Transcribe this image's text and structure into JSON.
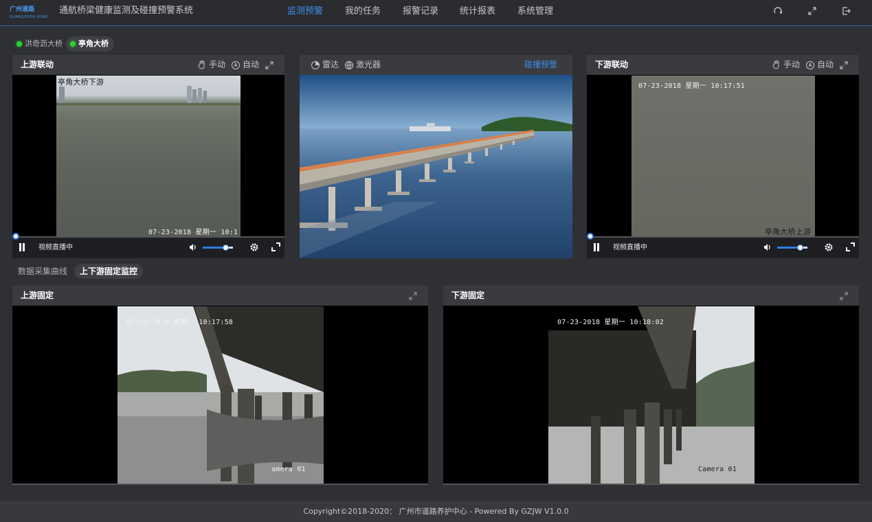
{
  "header": {
    "logo_text": "广州道路",
    "logo_sub": "GUANGZHOU ROAD",
    "title": "通航桥梁健康监测及碰撞预警系统",
    "nav": [
      {
        "label": "监测预警",
        "active": true
      },
      {
        "label": "我的任务",
        "active": false
      },
      {
        "label": "报警记录",
        "active": false
      },
      {
        "label": "统计报表",
        "active": false
      },
      {
        "label": "系统管理",
        "active": false
      }
    ],
    "icons": [
      "refresh-icon",
      "fullscreen-icon",
      "logout-icon"
    ]
  },
  "bridges": [
    {
      "label": "洪奇沥大桥",
      "status": "online",
      "active": false
    },
    {
      "label": "亭角大桥",
      "status": "online",
      "active": true
    }
  ],
  "panels": {
    "upstream_linked": {
      "title": "上游联动",
      "manual_label": "手动",
      "auto_label": "自动",
      "overlay_top": "亭角大桥下游",
      "timestamp": "07-23-2018 星期一 10:1",
      "status": "视频直播中",
      "volume": 0.75
    },
    "center": {
      "radar_label": "雷达",
      "laser_label": "激光器",
      "warning_label": "碰撞预警"
    },
    "downstream_linked": {
      "title": "下游联动",
      "manual_label": "手动",
      "auto_label": "自动",
      "timestamp": "07-23-2018 星期一 10:17:51",
      "overlay_bottom": "亭角大桥上游",
      "status": "视频直播中",
      "volume": 0.75
    }
  },
  "subtabs": [
    {
      "label": "数据采集曲线",
      "active": false
    },
    {
      "label": "上下游固定监控",
      "active": true
    }
  ],
  "fixed": {
    "upstream": {
      "title": "上游固定",
      "timestamp": "07-23-2018 星期一 10:17:58",
      "camera": "amera 01"
    },
    "downstream": {
      "title": "下游固定",
      "timestamp": "07-23-2018 星期一 10:18:02",
      "camera": "Camera 01"
    }
  },
  "footer": {
    "text": "Copyright©2018-2020： 广州市道路养护中心 - Powered By GZJW V1.0.0"
  },
  "colors": {
    "accent": "#3d8ee9",
    "online": "#29d12c",
    "header_rule": "#2c6bb5"
  }
}
